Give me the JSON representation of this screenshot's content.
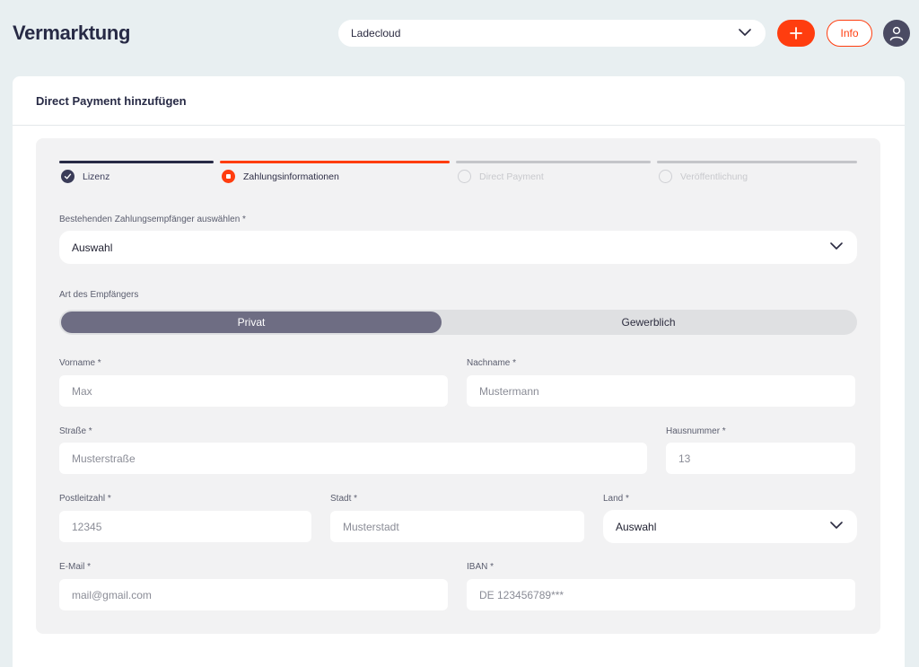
{
  "header": {
    "title": "Vermarktung",
    "org_select": "Ladecloud",
    "info_label": "Info"
  },
  "card": {
    "title": "Direct Payment hinzufügen"
  },
  "steps": [
    {
      "label": "Lizenz",
      "state": "done"
    },
    {
      "label": "Zahlungsinformationen",
      "state": "active"
    },
    {
      "label": "Direct Payment",
      "state": "pending"
    },
    {
      "label": "Veröffentlichung",
      "state": "pending"
    }
  ],
  "form": {
    "existing_label": "Bestehenden Zahlungsempfänger auswählen *",
    "existing_value": "Auswahl",
    "type_label": "Art des Empfängers",
    "type_private": "Privat",
    "type_business": "Gewerblich",
    "type_selected": "Privat",
    "firstname_label": "Vorname *",
    "firstname_placeholder": "Max",
    "lastname_label": "Nachname *",
    "lastname_placeholder": "Mustermann",
    "street_label": "Straße *",
    "street_placeholder": "Musterstraße",
    "housenumber_label": "Hausnummer *",
    "housenumber_placeholder": "13",
    "zip_label": "Postleitzahl *",
    "zip_placeholder": "12345",
    "city_label": "Stadt *",
    "city_placeholder": "Musterstadt",
    "country_label": "Land *",
    "country_value": "Auswahl",
    "email_label": "E-Mail *",
    "email_placeholder": "mail@gmail.com",
    "iban_label": "IBAN *",
    "iban_placeholder": "DE 123456789***"
  },
  "colors": {
    "accent": "#ff3d0f",
    "dark": "#272a45",
    "toggle_active": "#6e6d83",
    "pending": "#c4c5c9"
  }
}
